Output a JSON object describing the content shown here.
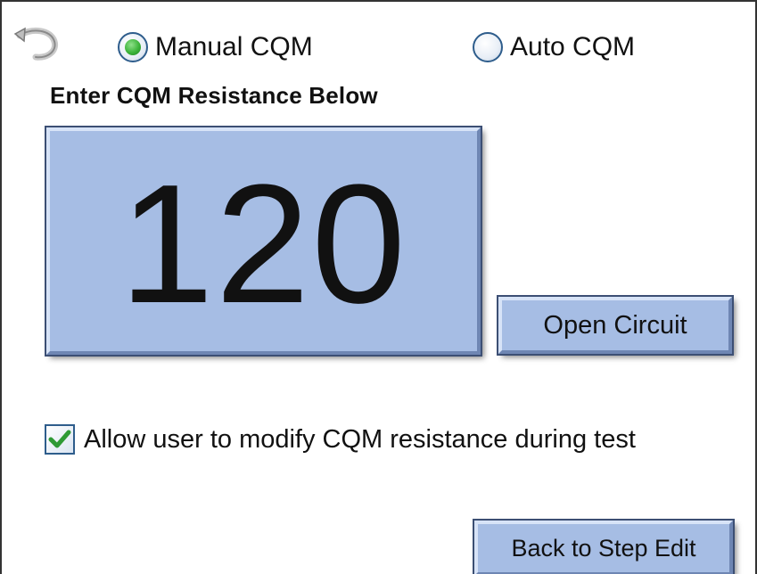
{
  "header": {
    "back_icon": "curved-back-arrow-icon",
    "mode_options": [
      {
        "label": "Manual CQM",
        "selected": true
      },
      {
        "label": "Auto CQM",
        "selected": false
      }
    ],
    "accent_color": "#3cb43a"
  },
  "main": {
    "title": "Enter CQM Resistance Below",
    "resistance_value": "120",
    "open_circuit_label": "Open Circuit",
    "button_color": "#a6bde4"
  },
  "options": {
    "allow_modify_label": "Allow user to modify CQM resistance during test",
    "allow_modify_checked": true,
    "check_color": "#2f9a35"
  },
  "footer": {
    "back_label": "Back to Step Edit"
  }
}
